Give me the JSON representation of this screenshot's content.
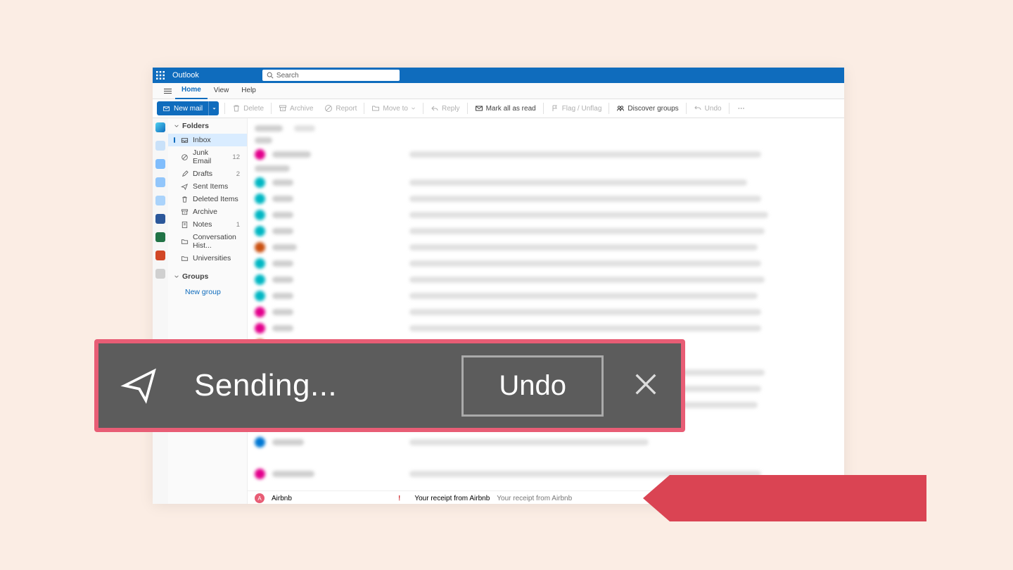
{
  "header": {
    "app_name": "Outlook",
    "search_placeholder": "Search"
  },
  "menus": {
    "home": "Home",
    "view": "View",
    "help": "Help"
  },
  "toolbar": {
    "new_mail": "New mail",
    "delete": "Delete",
    "archive": "Archive",
    "report": "Report",
    "move_to": "Move to",
    "reply": "Reply",
    "mark_all_read": "Mark all as read",
    "flag": "Flag / Unflag",
    "discover": "Discover groups",
    "undo": "Undo"
  },
  "sidebar": {
    "folders_label": "Folders",
    "groups_label": "Groups",
    "new_group": "New group",
    "items": [
      {
        "label": "Inbox",
        "count": ""
      },
      {
        "label": "Junk Email",
        "count": "12"
      },
      {
        "label": "Drafts",
        "count": "2"
      },
      {
        "label": "Sent Items",
        "count": ""
      },
      {
        "label": "Deleted Items",
        "count": ""
      },
      {
        "label": "Archive",
        "count": ""
      },
      {
        "label": "Notes",
        "count": "1"
      },
      {
        "label": "Conversation Hist...",
        "count": ""
      },
      {
        "label": "Universities",
        "count": ""
      }
    ]
  },
  "bottom_mail": {
    "avatar_letter": "A",
    "sender": "Airbnb",
    "subject": "Your receipt from Airbnb",
    "preview": "Your receipt from Airbnb"
  },
  "toast": {
    "status": "Sending...",
    "undo": "Undo"
  }
}
